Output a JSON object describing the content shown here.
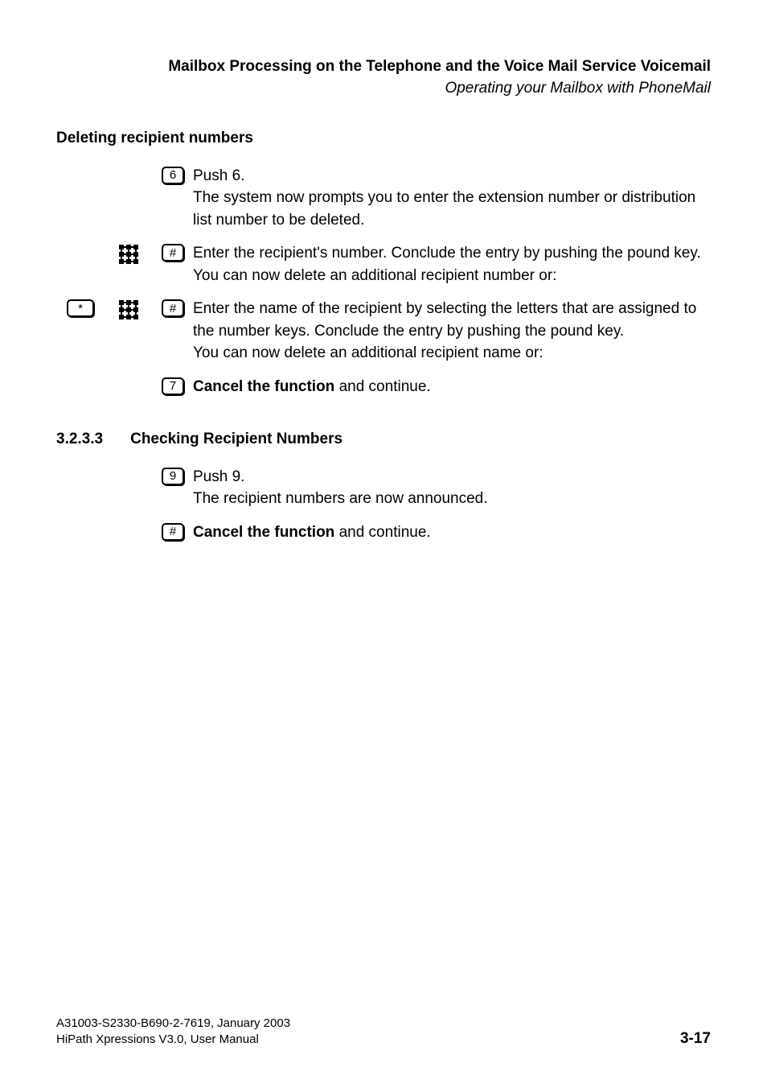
{
  "header": {
    "title": "Mailbox Processing on the Telephone and the Voice Mail Service Voicemail",
    "subtitle": "Operating your Mailbox with PhoneMail"
  },
  "section": {
    "heading": "Deleting recipient numbers"
  },
  "rows": [
    {
      "key": "6",
      "lead": "Push 6.",
      "text": "The system now prompts you to enter the extension number or distribution list number to be deleted."
    },
    {
      "left_icon": "",
      "mid_icon": "keypad",
      "key": "#",
      "lead": "",
      "text": "Enter the recipient's number. Conclude the entry by pushing the pound key.",
      "tail": "You can now delete an additional recipient number or:"
    },
    {
      "left_icon": "star-key",
      "mid_icon": "keypad",
      "key": "#",
      "lead": "",
      "text": "Enter the name of the recipient by selecting the letters that are assigned to the number keys. Conclude the entry by pushing the pound key.",
      "tail": "You can now delete an additional recipient name or:"
    },
    {
      "key": "7",
      "bold": "Cancel the function",
      "after": " and continue."
    }
  ],
  "subsection": {
    "number": "3.2.3.3",
    "title": "Checking Recipient Numbers"
  },
  "subrows": [
    {
      "key": "9",
      "lead": "Push 9.",
      "text": "The recipient numbers are now announced."
    },
    {
      "key": "#",
      "bold": "Cancel the function",
      "after": " and continue."
    }
  ],
  "footer": {
    "line1": "A31003-S2330-B690-2-7619, January 2003",
    "line2": "HiPath Xpressions V3.0, User Manual",
    "page": "3-17"
  }
}
